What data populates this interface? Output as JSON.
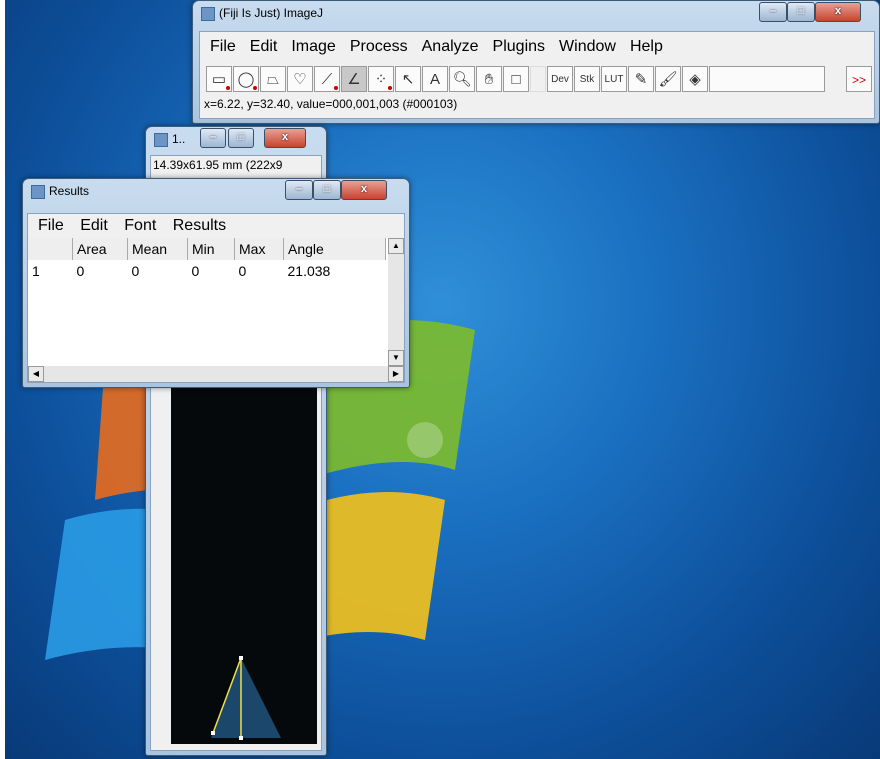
{
  "imagej": {
    "title": "(Fiji Is Just) ImageJ",
    "menu": [
      "File",
      "Edit",
      "Image",
      "Process",
      "Analyze",
      "Plugins",
      "Window",
      "Help"
    ],
    "tools": [
      "rectangle-tool",
      "oval-tool",
      "polygon-tool",
      "freehand-tool",
      "line-tool",
      "angle-tool",
      "point-tool",
      "wand-tool",
      "text-tool",
      "magnifier-tool",
      "hand-tool",
      "color-picker-tool"
    ],
    "text_tool_glyph": "A",
    "tool_labels": {
      "dev": "Dev",
      "stk": "Stk",
      "lut": "LUT",
      "more": ">>"
    },
    "status": "x=6.22, y=32.40, value=000,001,003 (#000103)"
  },
  "image_window": {
    "title": "1..",
    "subtitle": "14.39x61.95 mm (222x9"
  },
  "results": {
    "title": "Results",
    "menu": [
      "File",
      "Edit",
      "Font",
      "Results"
    ],
    "columns": [
      "",
      "Area",
      "Mean",
      "Min",
      "Max",
      "Angle"
    ],
    "rows": [
      [
        "1",
        "0",
        "0",
        "0",
        "0",
        "21.038"
      ]
    ]
  },
  "window_buttons": {
    "min": "–",
    "max": "□",
    "close": "x"
  },
  "colors": {
    "accent": "#1a6fc0",
    "status_text": "#000000"
  }
}
